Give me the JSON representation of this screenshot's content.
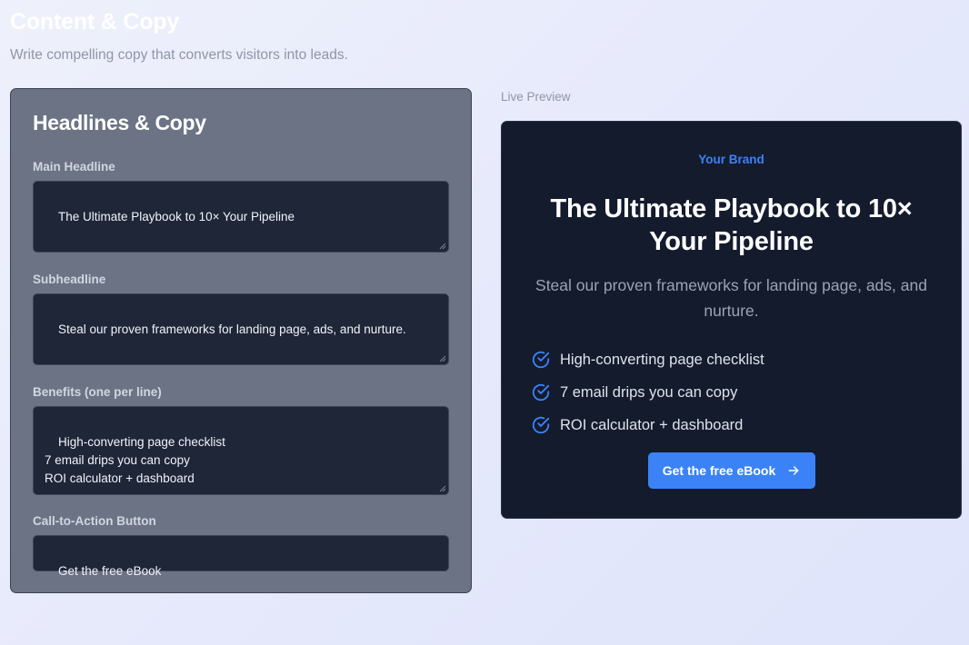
{
  "page": {
    "title": "Content & Copy",
    "subtitle": "Write compelling copy that converts visitors into leads."
  },
  "editor": {
    "heading": "Headlines & Copy",
    "fields": {
      "main_headline": {
        "label": "Main Headline",
        "value": "The Ultimate Playbook to 10× Your Pipeline"
      },
      "subheadline": {
        "label": "Subheadline",
        "value": "Steal our proven frameworks for landing page, ads, and nurture."
      },
      "benefits": {
        "label": "Benefits (one per line)",
        "value": "High-converting page checklist\n7 email drips you can copy\nROI calculator + dashboard"
      },
      "cta": {
        "label": "Call-to-Action Button",
        "value": "Get the free eBook"
      }
    }
  },
  "preview": {
    "label": "Live Preview",
    "brand": "Your Brand",
    "headline": "The Ultimate Playbook to 10× Your Pipeline",
    "subheadline": "Steal our proven frameworks for landing page, ads, and nurture.",
    "benefits": [
      {
        "text": "High-converting page checklist",
        "icon": "check-circle-icon"
      },
      {
        "text": "7 email drips you can copy",
        "icon": "check-circle-icon"
      },
      {
        "text": "ROI calculator + dashboard",
        "icon": "check-circle-icon"
      }
    ],
    "cta_label": "Get the free eBook",
    "cta_icon": "arrow-right-icon"
  },
  "colors": {
    "accent": "#3b82f6",
    "preview_bg": "#141b2d",
    "editor_bg": "#6b7385",
    "field_bg": "#1e2638"
  }
}
